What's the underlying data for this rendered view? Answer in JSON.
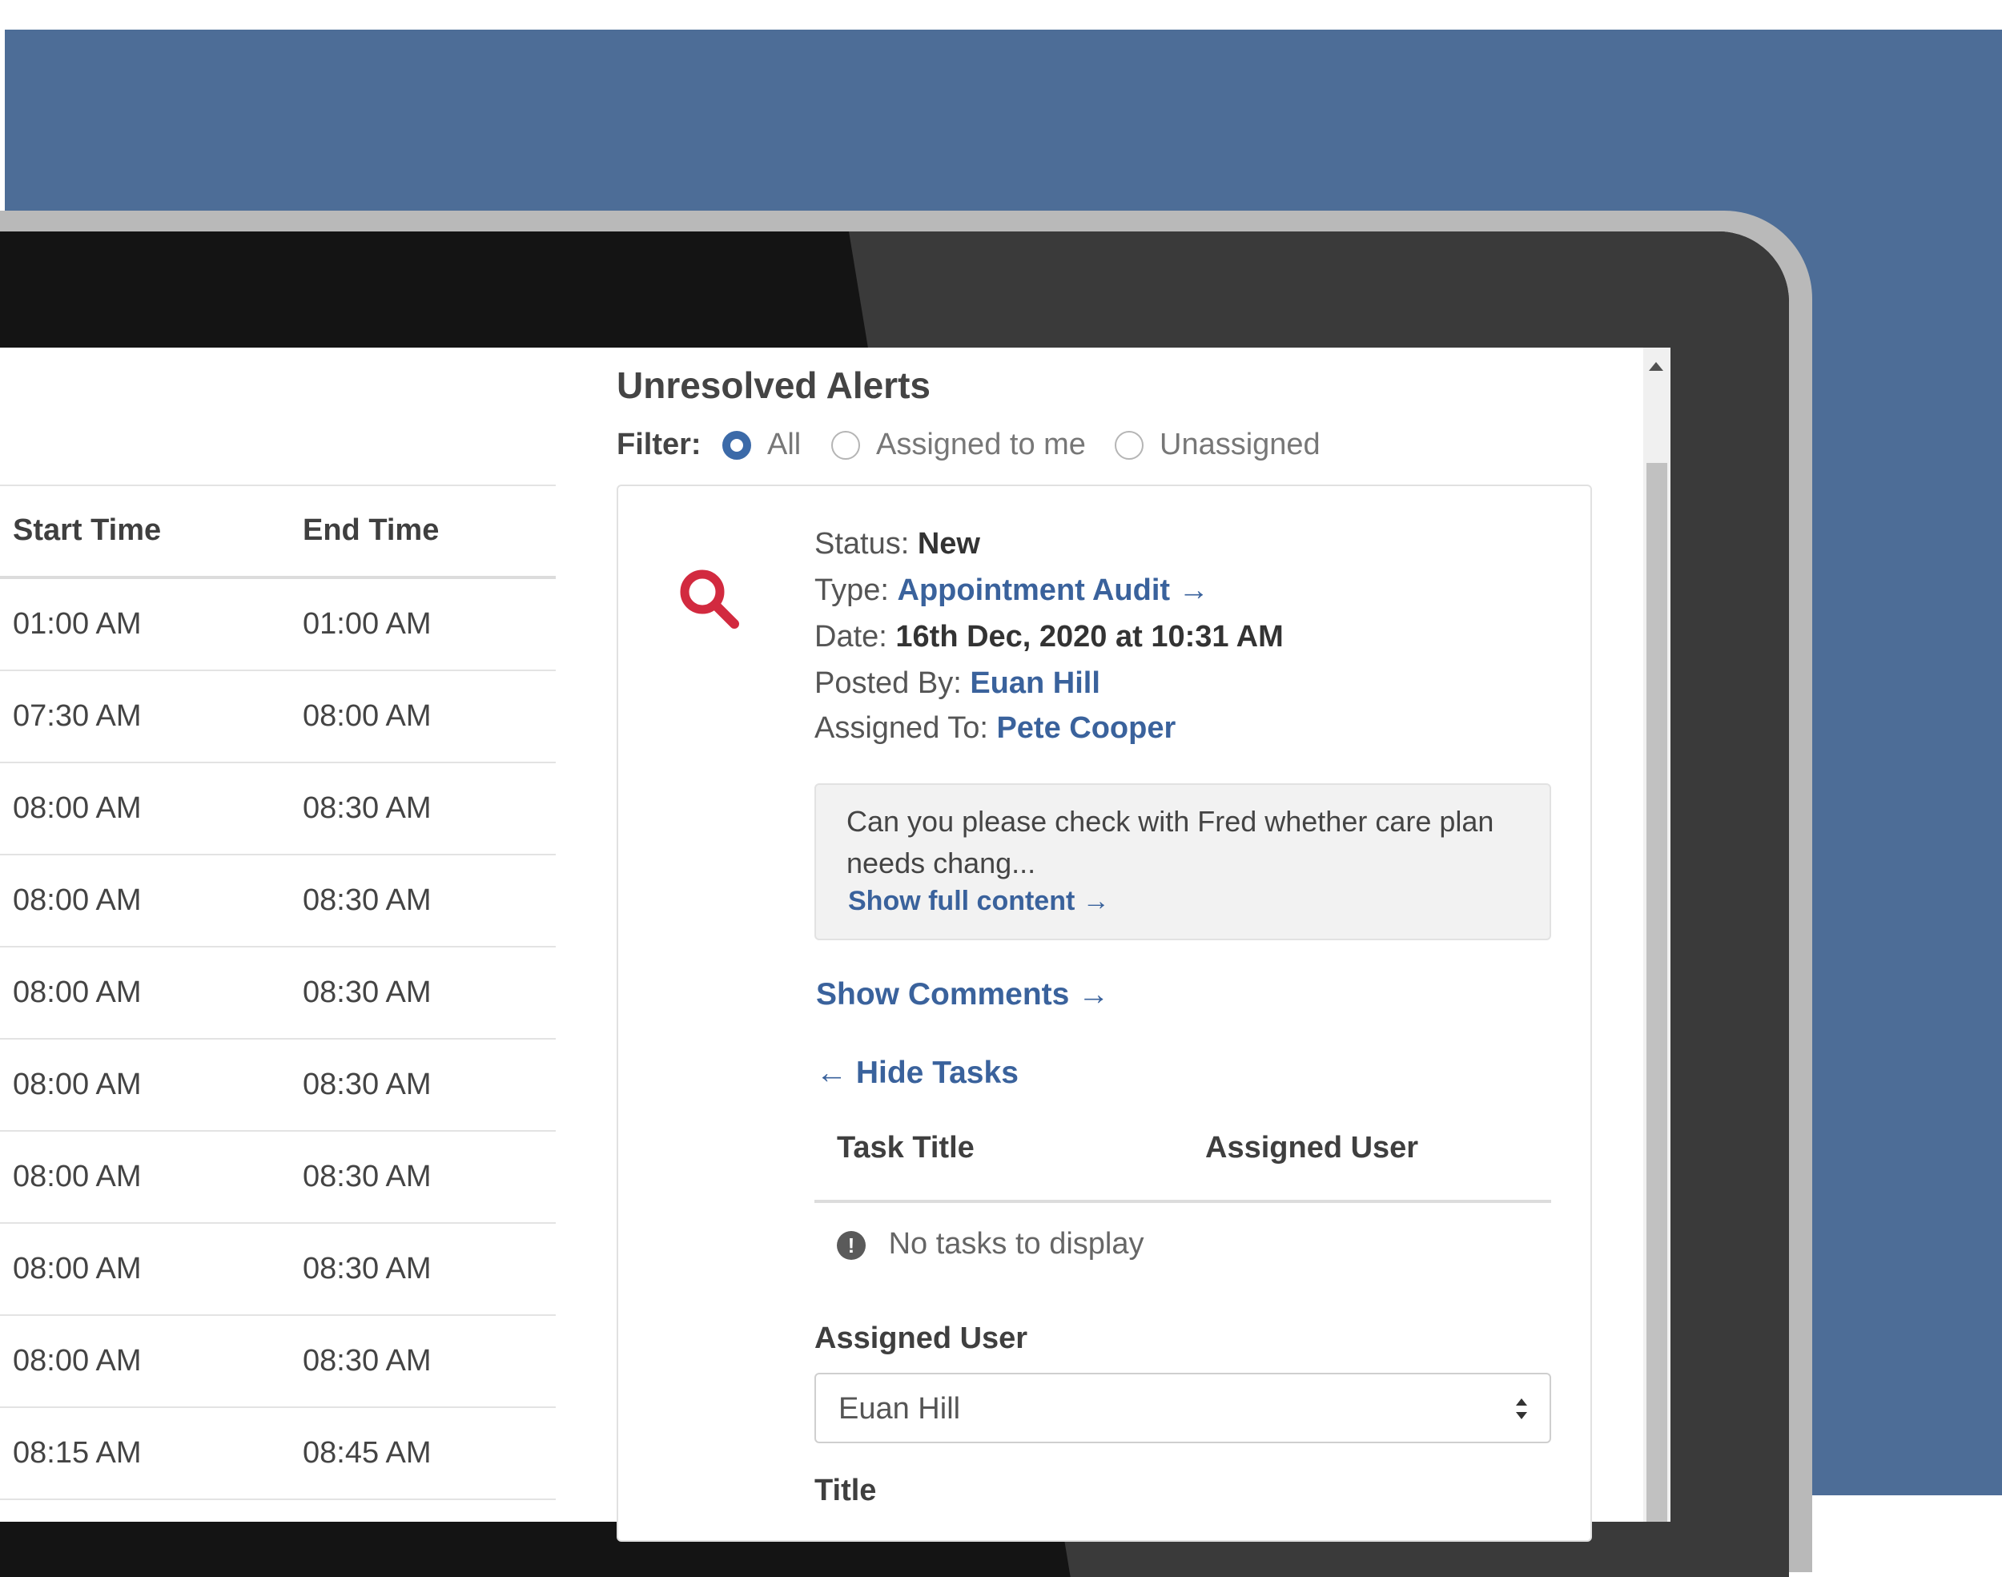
{
  "schedule": {
    "headers": {
      "start": "Start Time",
      "end": "End Time"
    },
    "rows": [
      {
        "start": "01:00 AM",
        "end": "01:00 AM"
      },
      {
        "start": "07:30 AM",
        "end": "08:00 AM"
      },
      {
        "start": "08:00 AM",
        "end": "08:30 AM"
      },
      {
        "start": "08:00 AM",
        "end": "08:30 AM"
      },
      {
        "start": "08:00 AM",
        "end": "08:30 AM"
      },
      {
        "start": "08:00 AM",
        "end": "08:30 AM"
      },
      {
        "start": "08:00 AM",
        "end": "08:30 AM"
      },
      {
        "start": "08:00 AM",
        "end": "08:30 AM"
      },
      {
        "start": "08:00 AM",
        "end": "08:30 AM"
      },
      {
        "start": "08:15 AM",
        "end": "08:45 AM"
      }
    ]
  },
  "alerts": {
    "title": "Unresolved Alerts",
    "filter": {
      "label": "Filter:",
      "options": [
        "All",
        "Assigned to me",
        "Unassigned"
      ],
      "selected": "All"
    },
    "icon": "search-icon",
    "status": {
      "label": "Status:",
      "value": "New"
    },
    "type": {
      "label": "Type:",
      "value": "Appointment Audit"
    },
    "date": {
      "label": "Date:",
      "value": "16th Dec, 2020 at 10:31 AM"
    },
    "posted_by": {
      "label": "Posted By:",
      "value": "Euan Hill"
    },
    "assigned_to": {
      "label": "Assigned To:",
      "value": "Pete Cooper"
    },
    "message": {
      "text": "Can you please check with Fred whether care plan needs chang...",
      "show_full": "Show full content"
    },
    "show_comments": "Show Comments",
    "hide_tasks": "Hide Tasks",
    "tasks": {
      "headers": {
        "title": "Task Title",
        "user": "Assigned User"
      },
      "empty": "No tasks to display"
    },
    "form": {
      "assigned_user_label": "Assigned User",
      "assigned_user_value": "Euan Hill",
      "title_label": "Title"
    }
  },
  "colors": {
    "backdrop": "#4d6d97",
    "link": "#3a629c",
    "radio_selected": "#3c6aa8",
    "alert_icon": "#d22a3f"
  }
}
